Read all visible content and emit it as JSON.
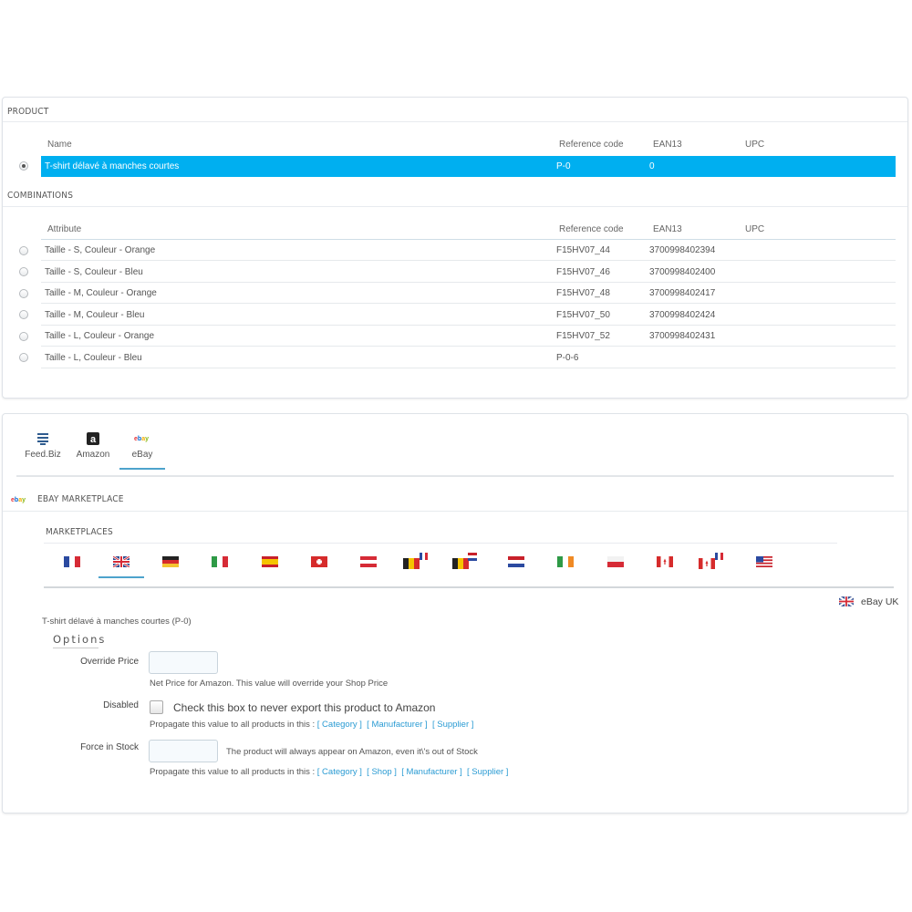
{
  "product": {
    "heading": "PRODUCT",
    "columns": [
      "Name",
      "Reference code",
      "EAN13",
      "UPC"
    ],
    "row": {
      "name": "T-shirt délavé à manches courtes",
      "reference": "P-0",
      "ean13": "0",
      "upc": ""
    }
  },
  "combinations": {
    "heading": "COMBINATIONS",
    "columns": [
      "Attribute",
      "Reference code",
      "EAN13",
      "UPC"
    ],
    "rows": [
      {
        "attribute": "Taille - S, Couleur - Orange",
        "reference": "F15HV07_44",
        "ean13": "3700998402394"
      },
      {
        "attribute": "Taille - S, Couleur - Bleu",
        "reference": "F15HV07_46",
        "ean13": "3700998402400"
      },
      {
        "attribute": "Taille - M, Couleur - Orange",
        "reference": "F15HV07_48",
        "ean13": "3700998402417"
      },
      {
        "attribute": "Taille - M, Couleur - Bleu",
        "reference": "F15HV07_50",
        "ean13": "3700998402424"
      },
      {
        "attribute": "Taille - L, Couleur - Orange",
        "reference": "F15HV07_52",
        "ean13": "3700998402431"
      },
      {
        "attribute": "Taille - L, Couleur - Bleu",
        "reference": "P-0-6",
        "ean13": ""
      }
    ]
  },
  "tabs": [
    {
      "label": "Feed.Biz",
      "icon": "feedbiz-icon"
    },
    {
      "label": "Amazon",
      "icon": "amazon-icon"
    },
    {
      "label": "eBay",
      "icon": "ebay-icon",
      "active": true
    }
  ],
  "marketplace": {
    "heading": "EBAY MARKETPLACE",
    "logo_text": "ebay",
    "subheading": "MARKETPLACES",
    "flags": [
      "france-flag",
      "uk-flag",
      "germany-flag",
      "italy-flag",
      "spain-flag",
      "switzerland-flag",
      "austria-flag",
      "belgium-fr-flag",
      "belgium-nl-flag",
      "netherlands-flag",
      "ireland-flag",
      "poland-flag",
      "canada-flag",
      "canada-fr-flag",
      "usa-flag"
    ],
    "selected_flag": "uk-flag",
    "site_label": "eBay UK"
  },
  "options": {
    "product_line": "T-shirt délavé à manches courtes (P-0)",
    "legend": "Options",
    "override_price": {
      "label": "Override Price",
      "value": "",
      "help": "Net Price for Amazon. This value will override your Shop Price"
    },
    "disabled": {
      "label": "Disabled",
      "checkbox_text": "Check this box to never export this product to Amazon",
      "checked": false,
      "propagate_text": "Propagate this value to all products in this :",
      "links": [
        "[ Category ]",
        "[ Manufacturer ]",
        "[ Supplier ]"
      ]
    },
    "force_in_stock": {
      "label": "Force in Stock",
      "value": "",
      "help": "The product will always appear on Amazon, even it\\'s out of Stock",
      "propagate_text": "Propagate this value to all products in this :",
      "links": [
        "[ Category ]",
        "[ Shop ]",
        "[ Manufacturer ]",
        "[ Supplier ]"
      ]
    }
  },
  "colors": {
    "selected_row": "#00aff0",
    "link": "#2a9bd3",
    "tab_underline": "#4da3cc"
  }
}
